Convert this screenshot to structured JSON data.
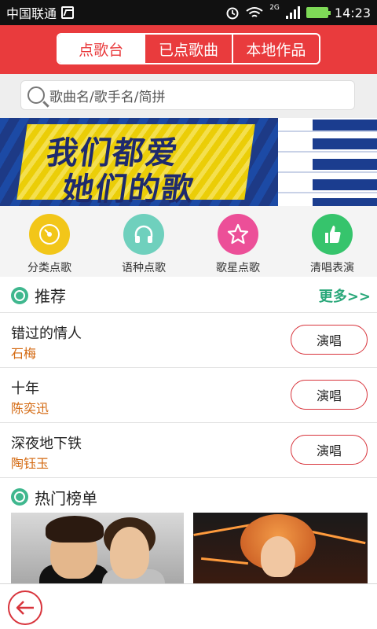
{
  "status_bar": {
    "carrier": "中国联通",
    "network": "2G",
    "time": "14:23"
  },
  "header": {
    "tabs": [
      {
        "label": "点歌台",
        "active": true
      },
      {
        "label": "已点歌曲",
        "active": false
      },
      {
        "label": "本地作品",
        "active": false
      }
    ]
  },
  "search": {
    "placeholder": "歌曲名/歌手名/简拼"
  },
  "banner": {
    "line1": "我们都爱",
    "line2": "她们的歌"
  },
  "categories": [
    {
      "label": "分类点歌",
      "icon": "disc-icon",
      "color": "#f2c619"
    },
    {
      "label": "语种点歌",
      "icon": "headphones-icon",
      "color": "#6fd0bd"
    },
    {
      "label": "歌星点歌",
      "icon": "star-icon",
      "color": "#ec4f98"
    },
    {
      "label": "清唱表演",
      "icon": "thumbs-up-icon",
      "color": "#36c46c"
    }
  ],
  "recommend": {
    "title": "推荐",
    "more": "更多>>",
    "songs": [
      {
        "name": "错过的情人",
        "singer": "石梅",
        "action": "演唱"
      },
      {
        "name": "十年",
        "singer": "陈奕迅",
        "action": "演唱"
      },
      {
        "name": "深夜地下铁",
        "singer": "陶钰玉",
        "action": "演唱"
      }
    ]
  },
  "hot_list": {
    "title": "热门榜单"
  },
  "colors": {
    "brand_red": "#e93b3d",
    "accent_green": "#2aa87a",
    "singer_orange": "#d46a12"
  }
}
